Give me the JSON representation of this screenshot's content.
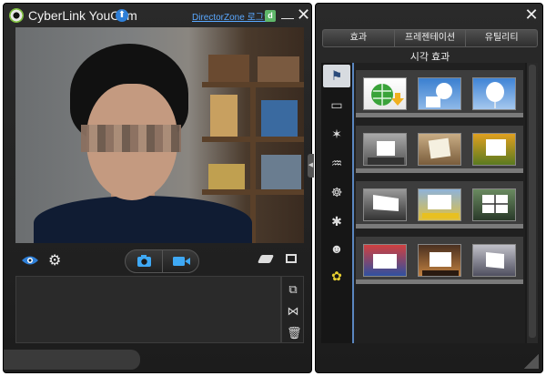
{
  "app": {
    "title": "CyberLink YouCam",
    "director_zone_link": "DirectorZone 로그인",
    "dz_badge": "d"
  },
  "window_controls": {
    "minimize": "—",
    "close": "✕"
  },
  "update_icon": "⬆",
  "camera_toolbar": {
    "eye_icon": "eye-icon",
    "settings_icon": "⚙"
  },
  "tray_side_icons": [
    "⧉",
    "⋈",
    "🗑"
  ],
  "effects_panel": {
    "tabs": [
      "효과",
      "프레젠테이션",
      "유틸리티"
    ],
    "active_tab": "효과",
    "title": "시각 효과",
    "categories": [
      "flag-icon",
      "frame-icon",
      "magic-wand-icon",
      "mask-icon",
      "avatar-icon",
      "particle-icon",
      "emoticon-icon",
      "sticker-icon"
    ],
    "category_glyphs": [
      "⚑",
      "▭",
      "✶",
      "♒",
      "☸",
      "✱",
      "☻",
      "✿"
    ]
  },
  "colors": {
    "window_bg": "#242424",
    "accent": "#2e7fd8",
    "link": "#5aa8ff"
  }
}
